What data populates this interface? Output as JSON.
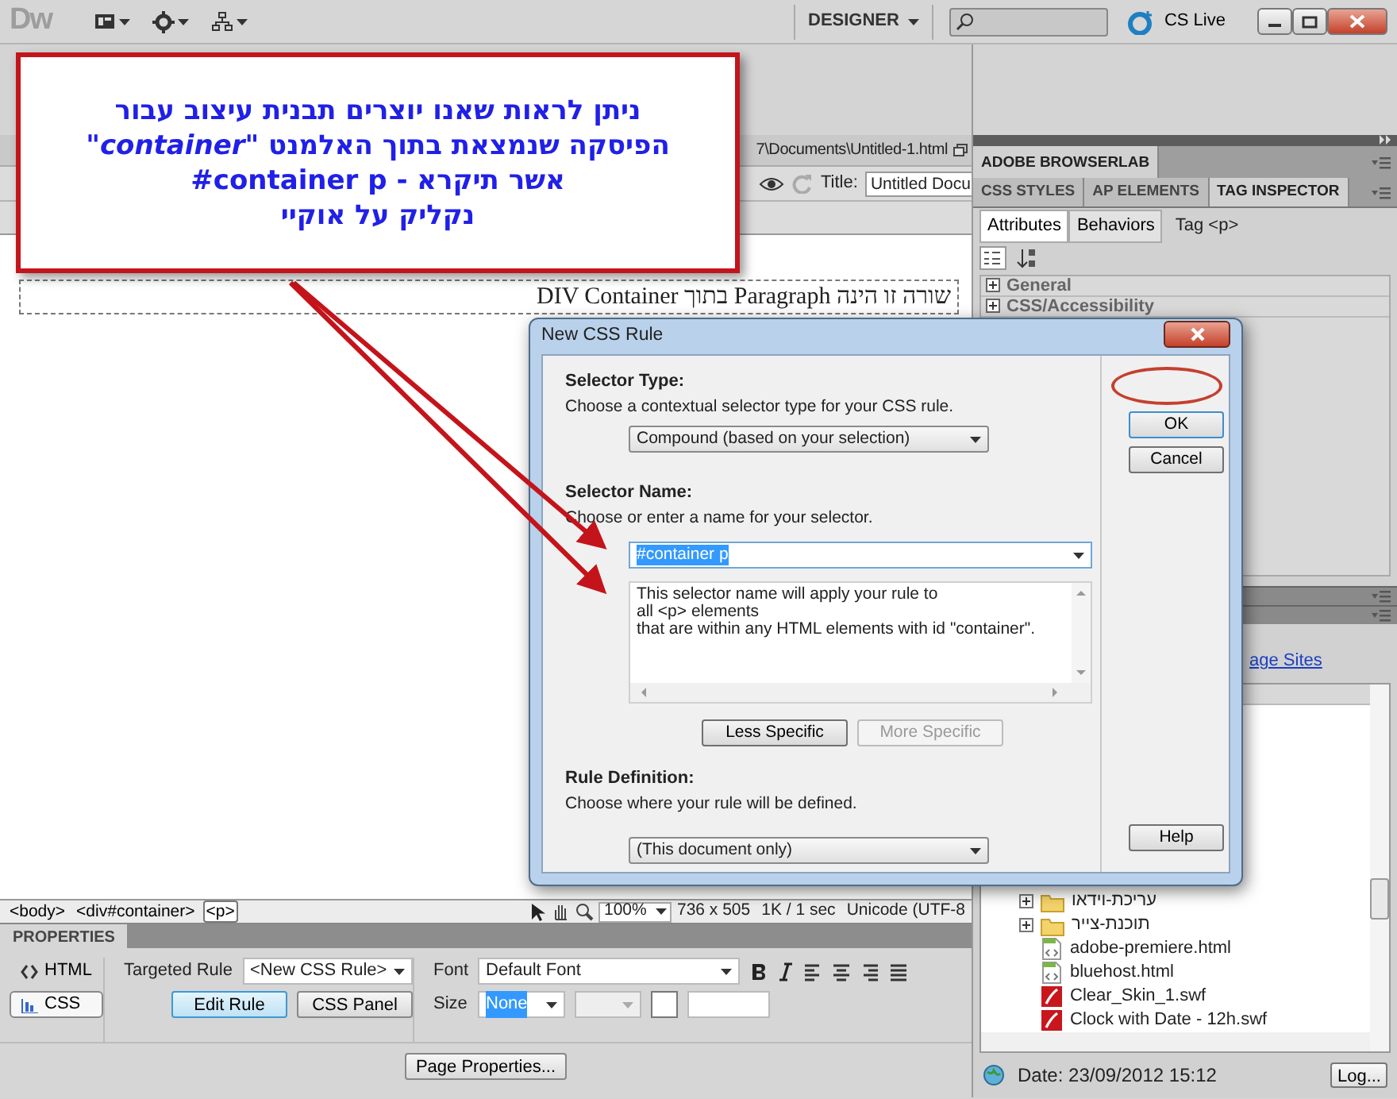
{
  "app_bar": {
    "logo": "Dw",
    "workspace": "DESIGNER",
    "cs_live": "CS Live"
  },
  "document": {
    "path": "7\\Documents\\Untitled-1.html",
    "title_label": "Title:",
    "title_value": "Untitled Docu",
    "paragraph": "שורה זו הינה Paragraph בתוך DIV Container"
  },
  "tag_selector": [
    {
      "label": "<body>",
      "selected": false
    },
    {
      "label": "<div#container>",
      "selected": false
    },
    {
      "label": "<p>",
      "selected": true
    }
  ],
  "doc_status": {
    "zoom": "100%",
    "size": "736 x 505",
    "download": "1K / 1 sec",
    "encoding": "Unicode (UTF-8"
  },
  "properties": {
    "title": "PROPERTIES",
    "modes": [
      {
        "label": "HTML",
        "selected": false
      },
      {
        "label": "CSS",
        "selected": true
      }
    ],
    "targeted_rule_label": "Targeted Rule",
    "targeted_rule": "<New CSS Rule>",
    "buttons": [
      {
        "label": "Edit Rule",
        "focused": true
      },
      {
        "label": "CSS Panel",
        "focused": false
      }
    ],
    "font_label": "Font",
    "font": "Default Font",
    "size_label": "Size",
    "size": "None",
    "page_properties": "Page Properties..."
  },
  "panels": {
    "browserlab": "ADOBE BROWSERLAB",
    "tabs": [
      {
        "label": "CSS STYLES",
        "selected": false
      },
      {
        "label": "AP ELEMENTS",
        "selected": false
      },
      {
        "label": "TAG INSPECTOR",
        "selected": true
      }
    ],
    "subtabs": [
      {
        "label": "Attributes",
        "selected": true
      },
      {
        "label": "Behaviors",
        "selected": false
      }
    ],
    "tag": "Tag <p>",
    "categories": [
      {
        "label": "General",
        "expanded": false
      },
      {
        "label": "CSS/Accessibility",
        "expanded": false
      }
    ]
  },
  "files": {
    "link": "age Sites",
    "items": [
      {
        "name": "עריכת-וידאו",
        "kind": "folder"
      },
      {
        "name": "תוכנת-צייר",
        "kind": "folder"
      },
      {
        "name": "adobe-premiere.html",
        "kind": "html"
      },
      {
        "name": "bluehost.html",
        "kind": "html"
      },
      {
        "name": "Clear_Skin_1.swf",
        "kind": "swf"
      },
      {
        "name": "Clock with Date - 12h.swf",
        "kind": "swf"
      }
    ],
    "date": "Date: 23/09/2012 15:12",
    "log_button": "Log..."
  },
  "dialog": {
    "title": "New CSS Rule",
    "selector_type_label": "Selector Type:",
    "selector_type_hint": "Choose a contextual selector type for your CSS rule.",
    "selector_type": "Compound (based on your selection)",
    "selector_name_label": "Selector Name:",
    "selector_name_hint": "Choose or enter a name for your selector.",
    "selector_name": "#container p",
    "description": "This selector name will apply your rule to\nall <p> elements\nthat are within any HTML elements with id \"container\".",
    "specific_buttons": [
      {
        "label": "Less Specific",
        "disabled": false
      },
      {
        "label": "More Specific",
        "disabled": true
      }
    ],
    "rule_definition_label": "Rule Definition:",
    "rule_definition_hint": "Choose where your rule will be defined.",
    "rule_definition": "(This document only)",
    "ok": "OK",
    "cancel": "Cancel",
    "help": "Help"
  },
  "callout": {
    "lines": [
      "ניתן לראות שאנו יוצרים תבנית עיצוב עבור",
      "הפיסקה שנמצאת בתוך האלמנט *\"container\"*",
      "#container p - אשר תיקרא",
      "נקליק על אוקיי"
    ]
  }
}
